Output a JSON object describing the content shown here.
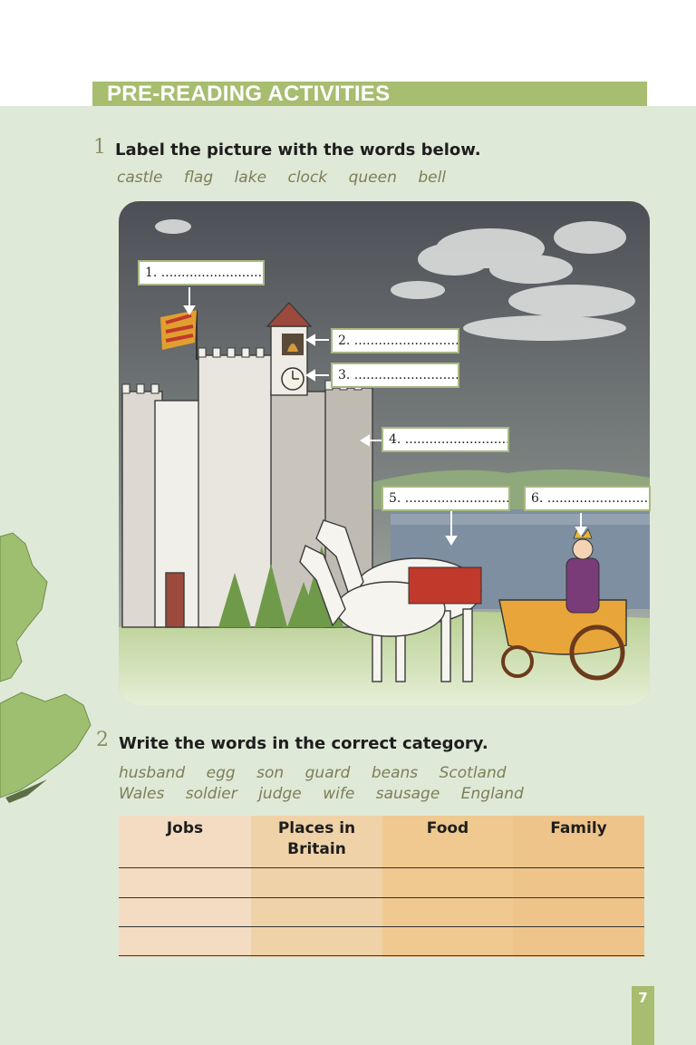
{
  "header": {
    "title": "PRE-READING ACTIVITIES"
  },
  "exercise1": {
    "number": "1",
    "instruction": "Label the picture with the words below.",
    "words": [
      "castle",
      "flag",
      "lake",
      "clock",
      "queen",
      "bell"
    ],
    "labels": [
      "1. ...........................",
      "2. ...........................",
      "3. ...........................",
      "4. ...........................",
      "5. ...........................",
      "6. ..........................."
    ]
  },
  "exercise2": {
    "number": "2",
    "instruction": "Write the words in the correct category.",
    "words_row1": [
      "husband",
      "egg",
      "son",
      "guard",
      "beans",
      "Scotland"
    ],
    "words_row2": [
      "Wales",
      "soldier",
      "judge",
      "wife",
      "sausage",
      "England"
    ],
    "table": {
      "headers": [
        "Jobs",
        "Places in\nBritain",
        "Food",
        "Family"
      ],
      "rows": [
        [
          "",
          "",
          "",
          ""
        ],
        [
          "",
          "",
          "",
          ""
        ],
        [
          "",
          "",
          "",
          ""
        ]
      ]
    }
  },
  "footer": {
    "page_number": "7"
  },
  "colors": {
    "band_green": "#a7bd6f",
    "page_green": "#dfe9d8",
    "word_olive": "#7c7e56",
    "col_light": "#f3dcc2",
    "col_dark": "#efc98f"
  }
}
